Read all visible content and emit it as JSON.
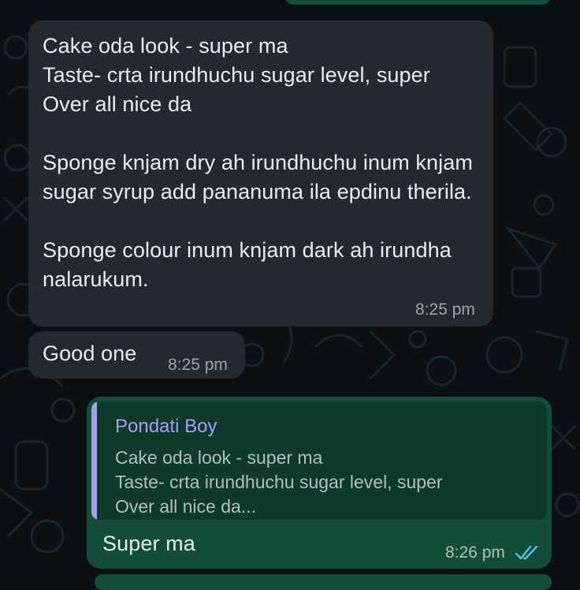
{
  "colors": {
    "incoming_bubble": "#232a2f",
    "outgoing_bubble": "#144d37",
    "quote_accent": "#a89cf5",
    "read_ticks": "#53bdeb"
  },
  "messages": [
    {
      "direction": "incoming",
      "text": "Cake oda look - super ma\nTaste- crta irundhuchu sugar level, super\nOver all nice da\n\nSponge knjam dry ah irundhuchu inum knjam sugar syrup add pananuma ila epdinu therila.\n\nSponge colour inum knjam dark  ah irundha nalarukum.",
      "time": "8:25 pm"
    },
    {
      "direction": "incoming",
      "text": "Good one",
      "time": "8:25 pm"
    },
    {
      "direction": "outgoing",
      "quote": {
        "author": "Pondati Boy",
        "text": "Cake oda look - super ma\nTaste- crta irundhuchu sugar level, super\nOver all nice da..."
      },
      "text": "Super ma",
      "time": "8:26 pm",
      "status_icon": "double-check-read-icon"
    }
  ]
}
